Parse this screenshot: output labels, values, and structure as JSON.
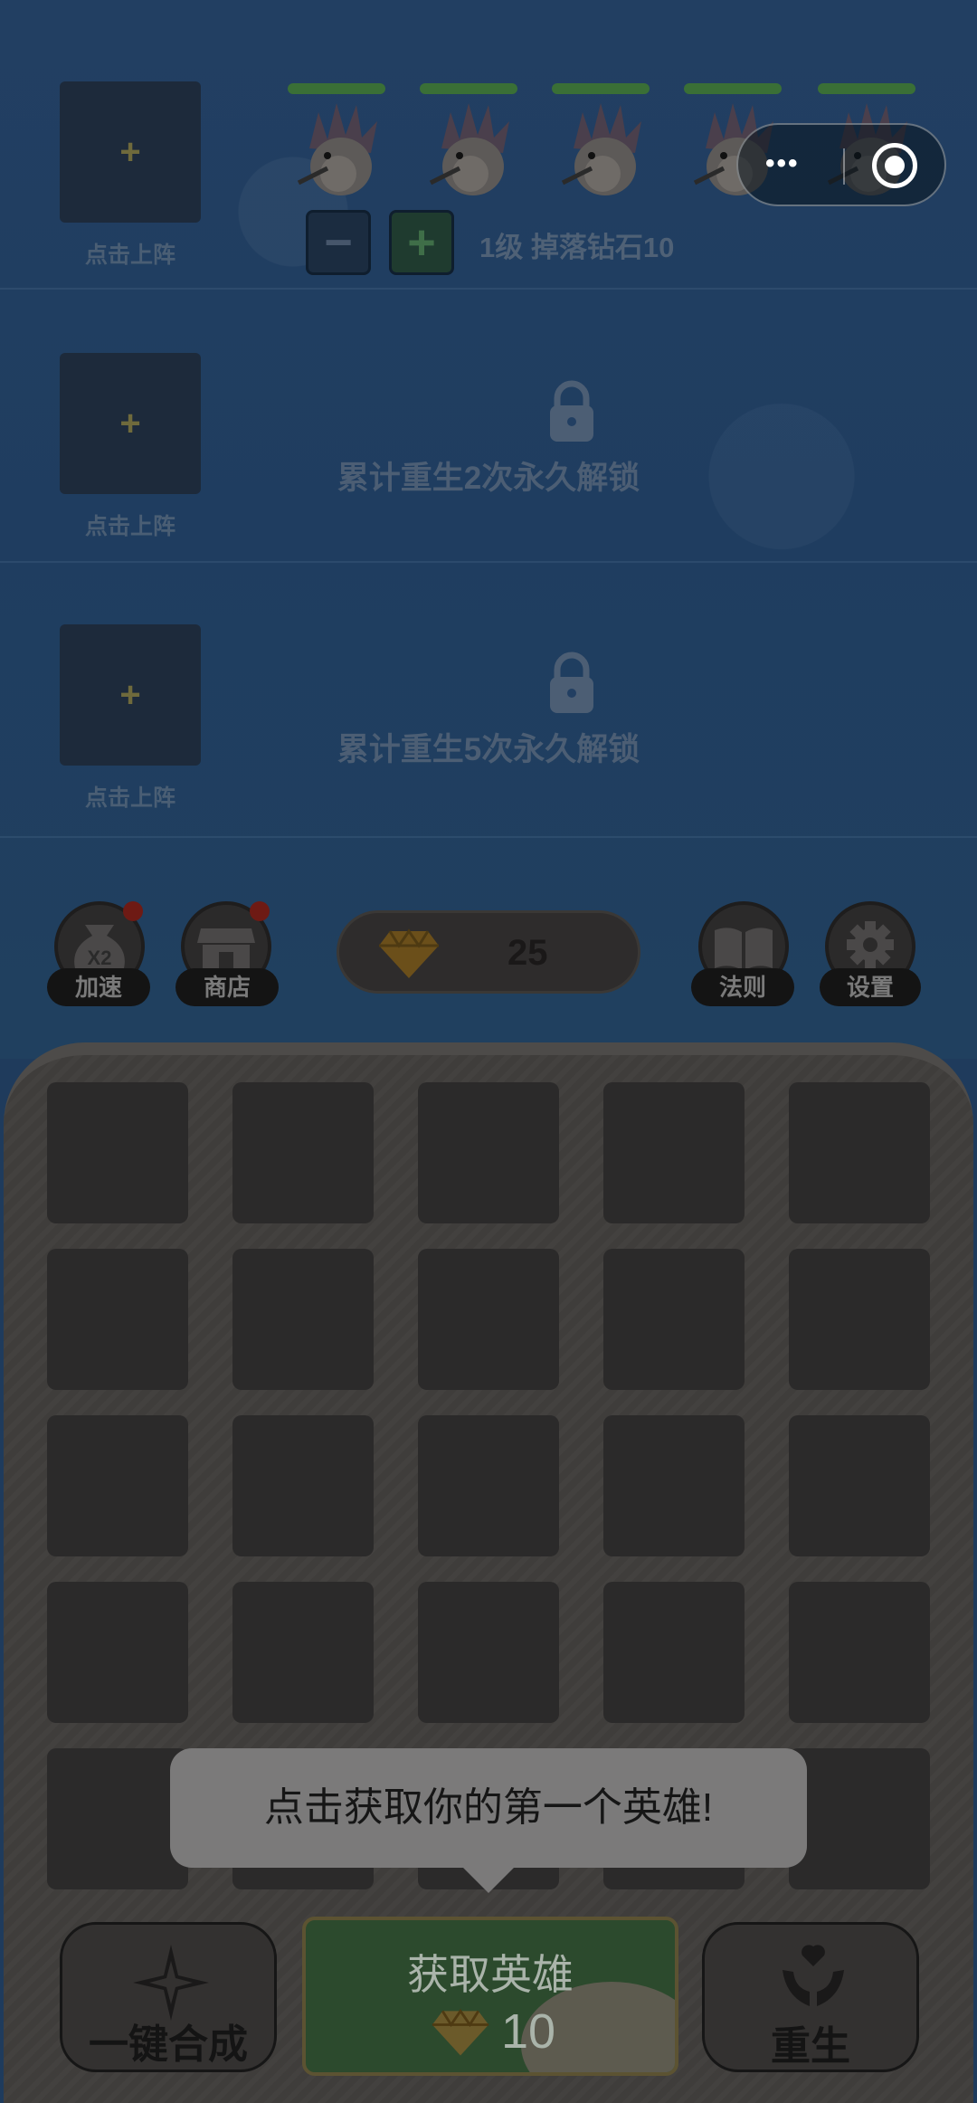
{
  "battlefield": {
    "slots": [
      {
        "plus": "+",
        "label": "点击上阵"
      },
      {
        "plus": "+",
        "label": "点击上阵"
      },
      {
        "plus": "+",
        "label": "点击上阵"
      }
    ],
    "enemy_count": 5,
    "level_text": "1级 掉落钻石10",
    "minus_label": "−",
    "plus_label": "+",
    "locks": [
      {
        "text": "累计重生2次永久解锁"
      },
      {
        "text": "累计重生5次永久解锁"
      }
    ]
  },
  "mini_program_capsule": {
    "menu_icon": "more-dots-icon",
    "close_icon": "target-circle-icon",
    "dots": "•••"
  },
  "toolbar": {
    "speed": {
      "label": "加速",
      "icon": "money-bag-x2-icon",
      "badge_text": "X2"
    },
    "shop": {
      "label": "商店",
      "icon": "shop-icon"
    },
    "gems": {
      "count": "25",
      "icon": "diamond-icon"
    },
    "rules": {
      "label": "法则",
      "icon": "book-icon"
    },
    "settings": {
      "label": "设置",
      "icon": "gear-icon"
    }
  },
  "bag": {
    "rows": 5,
    "cols": 5
  },
  "tooltip": {
    "text": "点击获取你的第一个英雄!"
  },
  "actions": {
    "merge_label": "一键合成",
    "get_hero_label": "获取英雄",
    "get_hero_price": "10",
    "rebirth_label": "重生"
  },
  "colors": {
    "accent_green": "#5c9e5a",
    "gem_gold": "#e8a82a",
    "overlay_dim": "rgba(0,0,0,0.55)"
  }
}
